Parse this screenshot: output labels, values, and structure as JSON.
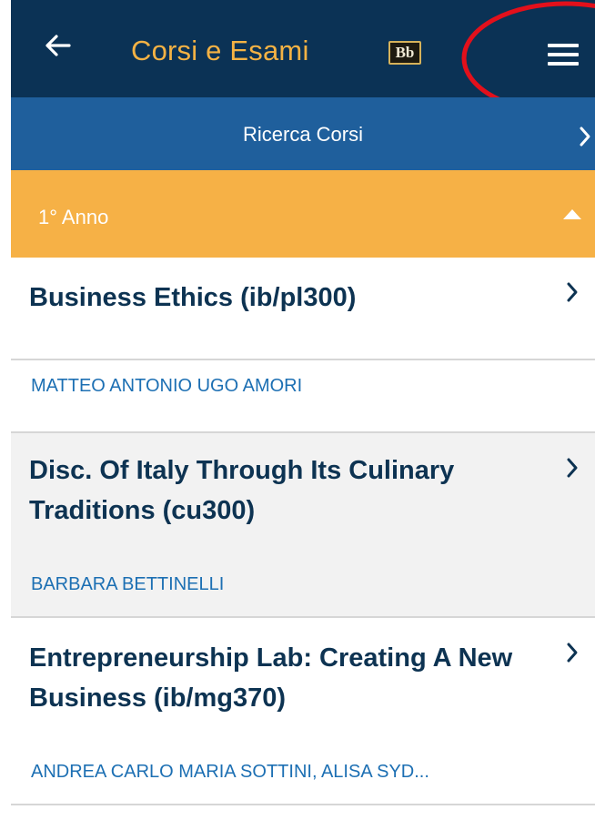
{
  "header": {
    "title": "Corsi e Esami",
    "logo_text": "Bb",
    "back_icon": "arrow-left-icon",
    "menu_icon": "hamburger-menu-icon",
    "background": "#0b3255",
    "title_color": "#f4b244"
  },
  "search": {
    "label": "Ricerca Corsi",
    "icon": "chevron-right-icon",
    "background": "#1f5f9c"
  },
  "section": {
    "label": "1° Anno",
    "icon": "caret-up-icon",
    "background": "#f6b146"
  },
  "courses": [
    {
      "title": "Business Ethics (ib/pl300)",
      "instructor": "MATTEO ANTONIO UGO AMORI"
    },
    {
      "title": "Disc. Of Italy Through Its Culinary Traditions (cu300)",
      "instructor": "BARBARA BETTINELLI"
    },
    {
      "title": "Entrepreneurship Lab: Creating A New Business (ib/mg370)",
      "instructor": "ANDREA CARLO MARIA SOTTINI, ALISA SYD..."
    }
  ],
  "colors": {
    "course_title": "#0d3352",
    "instructor": "#1c6fb3",
    "highlight_annotation": "#e3101b"
  }
}
